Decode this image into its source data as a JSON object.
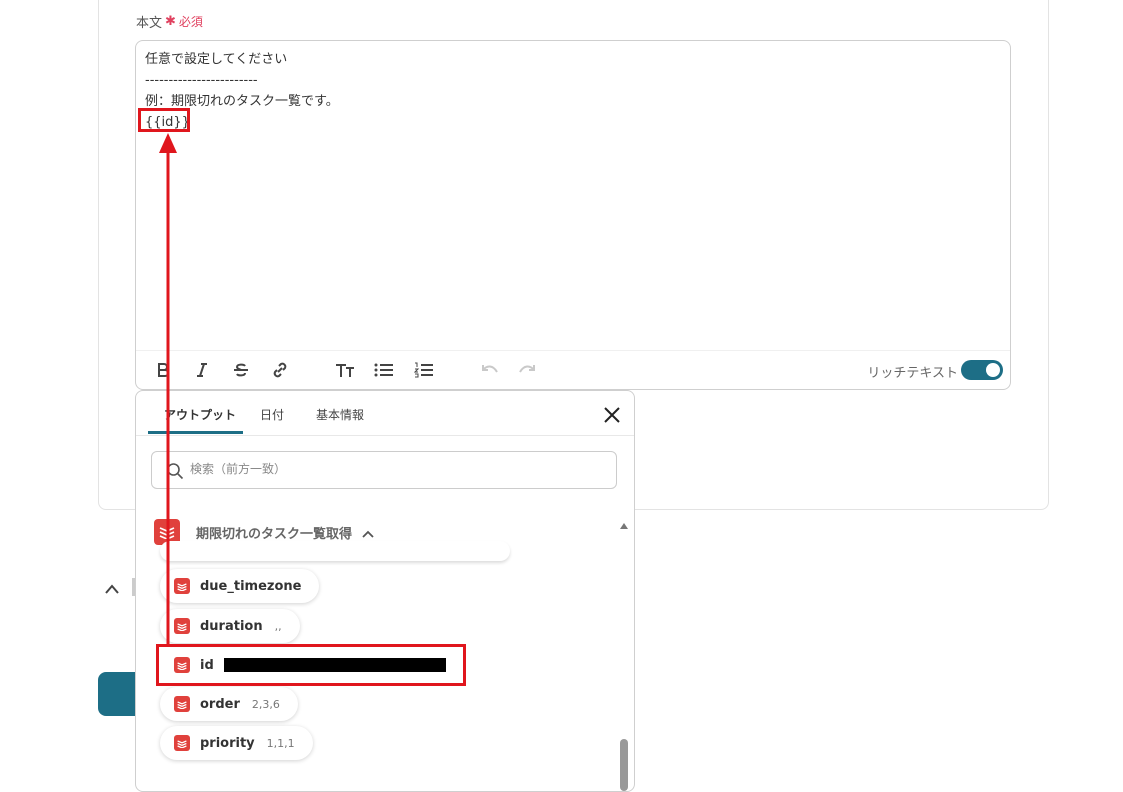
{
  "field": {
    "label": "本文",
    "required_star": "✱",
    "required_text": "必須"
  },
  "editor": {
    "lines": [
      "任意で設定してください",
      "------------------------",
      "例：期限切れのタスク一覧です。",
      "{{id}}"
    ],
    "rich_text_label": "リッチテキスト",
    "rich_text_on": true
  },
  "popup": {
    "tabs": [
      "アウトプット",
      "日付",
      "基本情報"
    ],
    "search_placeholder": "検索（前方一致）",
    "section_title": "期限切れのタスク一覧取得",
    "items": [
      {
        "name": "due_timezone",
        "value": ""
      },
      {
        "name": "duration",
        "value": ",,"
      },
      {
        "name": "id",
        "value": "",
        "redacted": true
      },
      {
        "name": "order",
        "value": "2,3,6"
      },
      {
        "name": "priority",
        "value": "1,1,1"
      }
    ]
  },
  "colors": {
    "accent": "#1d6e86",
    "required": "#e0415f",
    "annotation": "#e0161d",
    "app_icon": "#e0413c"
  }
}
